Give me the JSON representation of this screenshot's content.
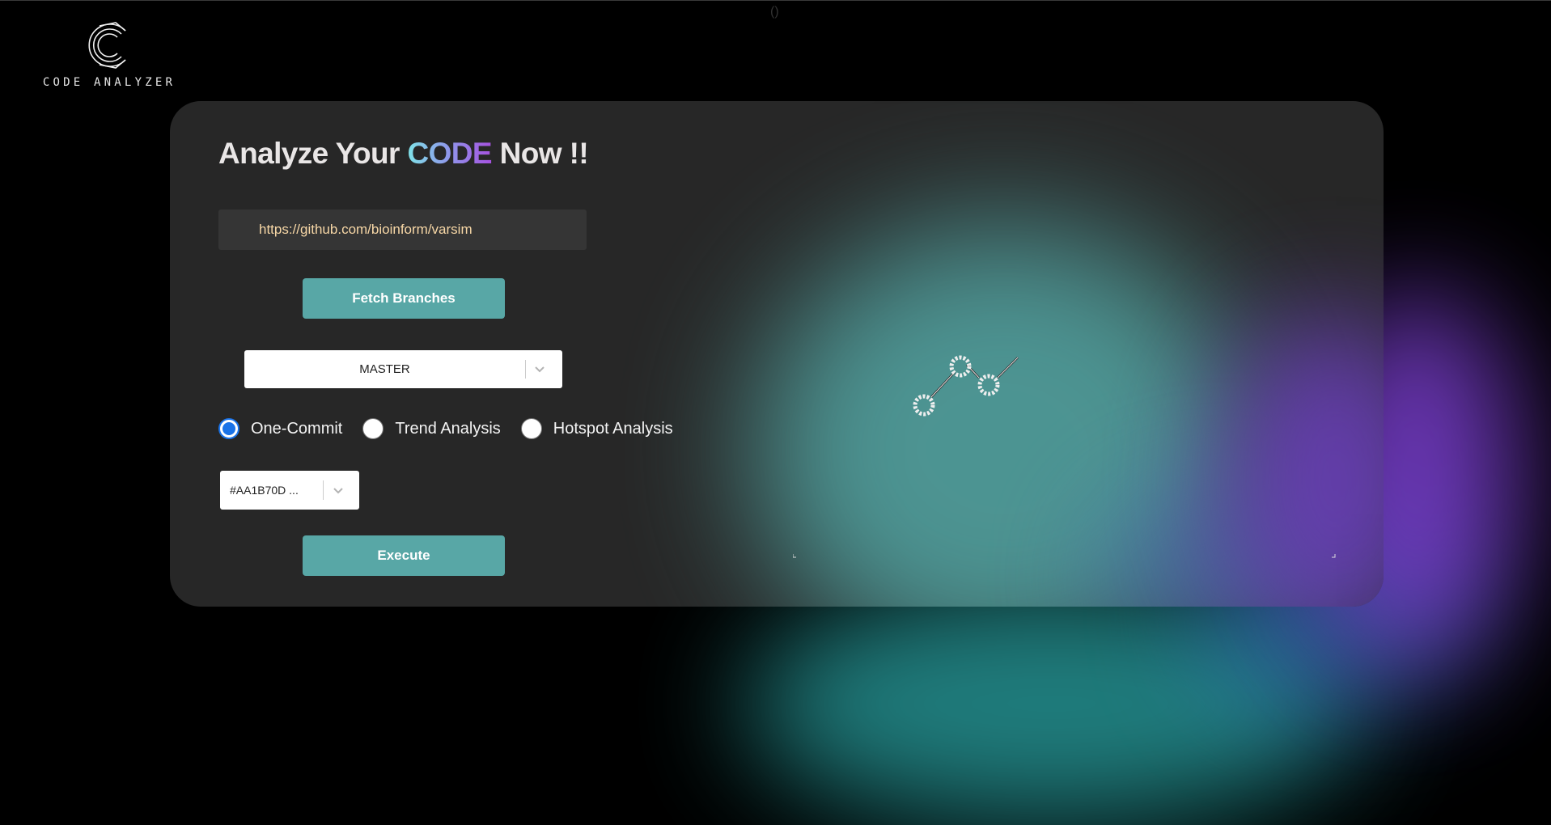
{
  "top_glyph": "()",
  "brand": {
    "name": "CODE ANALYZER"
  },
  "headline": {
    "prefix": "Analyze Your ",
    "highlight": "CODE",
    "suffix": " Now !!"
  },
  "repo": {
    "url_value": "https://github.com/bioinform/varsim",
    "placeholder": ""
  },
  "fetch_button_label": "Fetch Branches",
  "branch_select": {
    "selected": "MASTER"
  },
  "analysis_mode": {
    "options": [
      {
        "label": "One-Commit",
        "checked": true
      },
      {
        "label": "Trend Analysis",
        "checked": false
      },
      {
        "label": "Hotspot Analysis",
        "checked": false
      }
    ]
  },
  "commit_select": {
    "selected": "#AA1B70D ..."
  },
  "execute_button_label": "Execute",
  "colors": {
    "accent": "#58a7a6",
    "card_bg": "#272727",
    "url_text": "#f7d7a6",
    "radio_checked": "#1a73e8",
    "code_gradient": [
      "#7fe3e8",
      "#8f95ea",
      "#a651e0"
    ]
  },
  "icons": [
    "code-analyzer-logo-icon",
    "chevron-down-icon",
    "commit-graph-icon"
  ]
}
